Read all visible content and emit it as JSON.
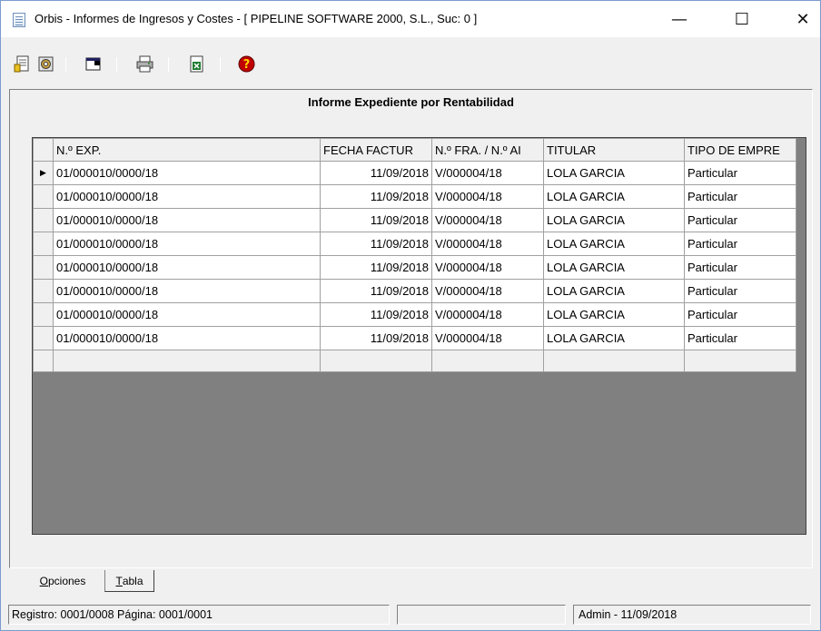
{
  "window": {
    "title": "Orbis - Informes de Ingresos y Costes - [ PIPELINE SOFTWARE 2000, S.L.,  Suc: 0 ]",
    "controls": {
      "minimize": "—",
      "maximize": "☐",
      "close": "✕"
    }
  },
  "toolbar": {
    "icons": [
      "new-document-icon",
      "settings-gear-icon",
      "window-icon",
      "printer-icon",
      "excel-export-icon",
      "help-icon"
    ]
  },
  "report": {
    "title": "Informe Expediente por Rentabilidad"
  },
  "grid": {
    "columns": [
      "N.º EXP.",
      "FECHA FACTUR",
      "N.º FRA. / N.º AI",
      "TITULAR",
      "TIPO DE EMPRE"
    ],
    "rows": [
      [
        "01/000010/0000/18",
        "11/09/2018",
        "V/000004/18",
        "LOLA GARCIA",
        "Particular"
      ],
      [
        "01/000010/0000/18",
        "11/09/2018",
        "V/000004/18",
        "LOLA GARCIA",
        "Particular"
      ],
      [
        "01/000010/0000/18",
        "11/09/2018",
        "V/000004/18",
        "LOLA GARCIA",
        "Particular"
      ],
      [
        "01/000010/0000/18",
        "11/09/2018",
        "V/000004/18",
        "LOLA GARCIA",
        "Particular"
      ],
      [
        "01/000010/0000/18",
        "11/09/2018",
        "V/000004/18",
        "LOLA GARCIA",
        "Particular"
      ],
      [
        "01/000010/0000/18",
        "11/09/2018",
        "V/000004/18",
        "LOLA GARCIA",
        "Particular"
      ],
      [
        "01/000010/0000/18",
        "11/09/2018",
        "V/000004/18",
        "LOLA GARCIA",
        "Particular"
      ],
      [
        "01/000010/0000/18",
        "11/09/2018",
        "V/000004/18",
        "LOLA GARCIA",
        "Particular"
      ]
    ],
    "current_row_indicator": "▶"
  },
  "tabs": [
    {
      "first": "O",
      "rest": "pciones"
    },
    {
      "first": "T",
      "rest": "abla"
    }
  ],
  "status": {
    "left": "Registro: 0001/0008  Página: 0001/0001",
    "middle": "",
    "right": "Admin - 11/09/2018"
  }
}
